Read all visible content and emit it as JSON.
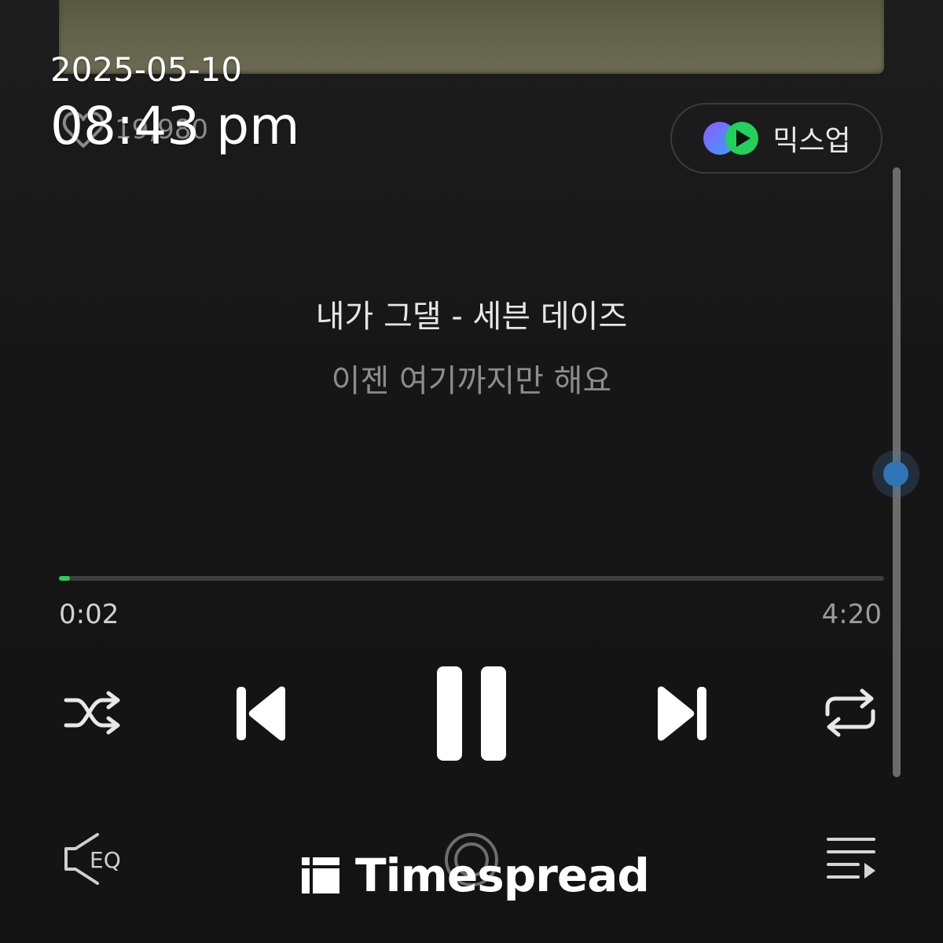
{
  "overlay": {
    "date": "2025-05-10",
    "time": "08:43 pm"
  },
  "likes": {
    "count": "19,980",
    "icon": "heart-outline-icon"
  },
  "mixup_button": {
    "label": "믹스업",
    "icon": "mixup-logo-icon"
  },
  "track": {
    "title_line": "내가 그댈 - 세븐 데이즈",
    "current_lyric": "이젠 여기까지만 해요"
  },
  "playback": {
    "elapsed": "0:02",
    "total": "4:20",
    "progress_fraction": 0.008,
    "state": "playing"
  },
  "controls": {
    "shuffle_icon": "shuffle-icon",
    "prev_icon": "skip-previous-icon",
    "pause_icon": "pause-icon",
    "next_icon": "skip-next-icon",
    "repeat_icon": "repeat-icon"
  },
  "bottom_bar": {
    "eq_label": "EQ",
    "eq_icon": "equalizer-speaker-icon",
    "center_icon": "cast-icon",
    "playlist_icon": "playlist-icon"
  },
  "watermark": {
    "brand": "Timespread"
  },
  "colors": {
    "accent_progress": "#23d15a",
    "scroll_thumb": "#2f74b4",
    "background": "#151515"
  }
}
